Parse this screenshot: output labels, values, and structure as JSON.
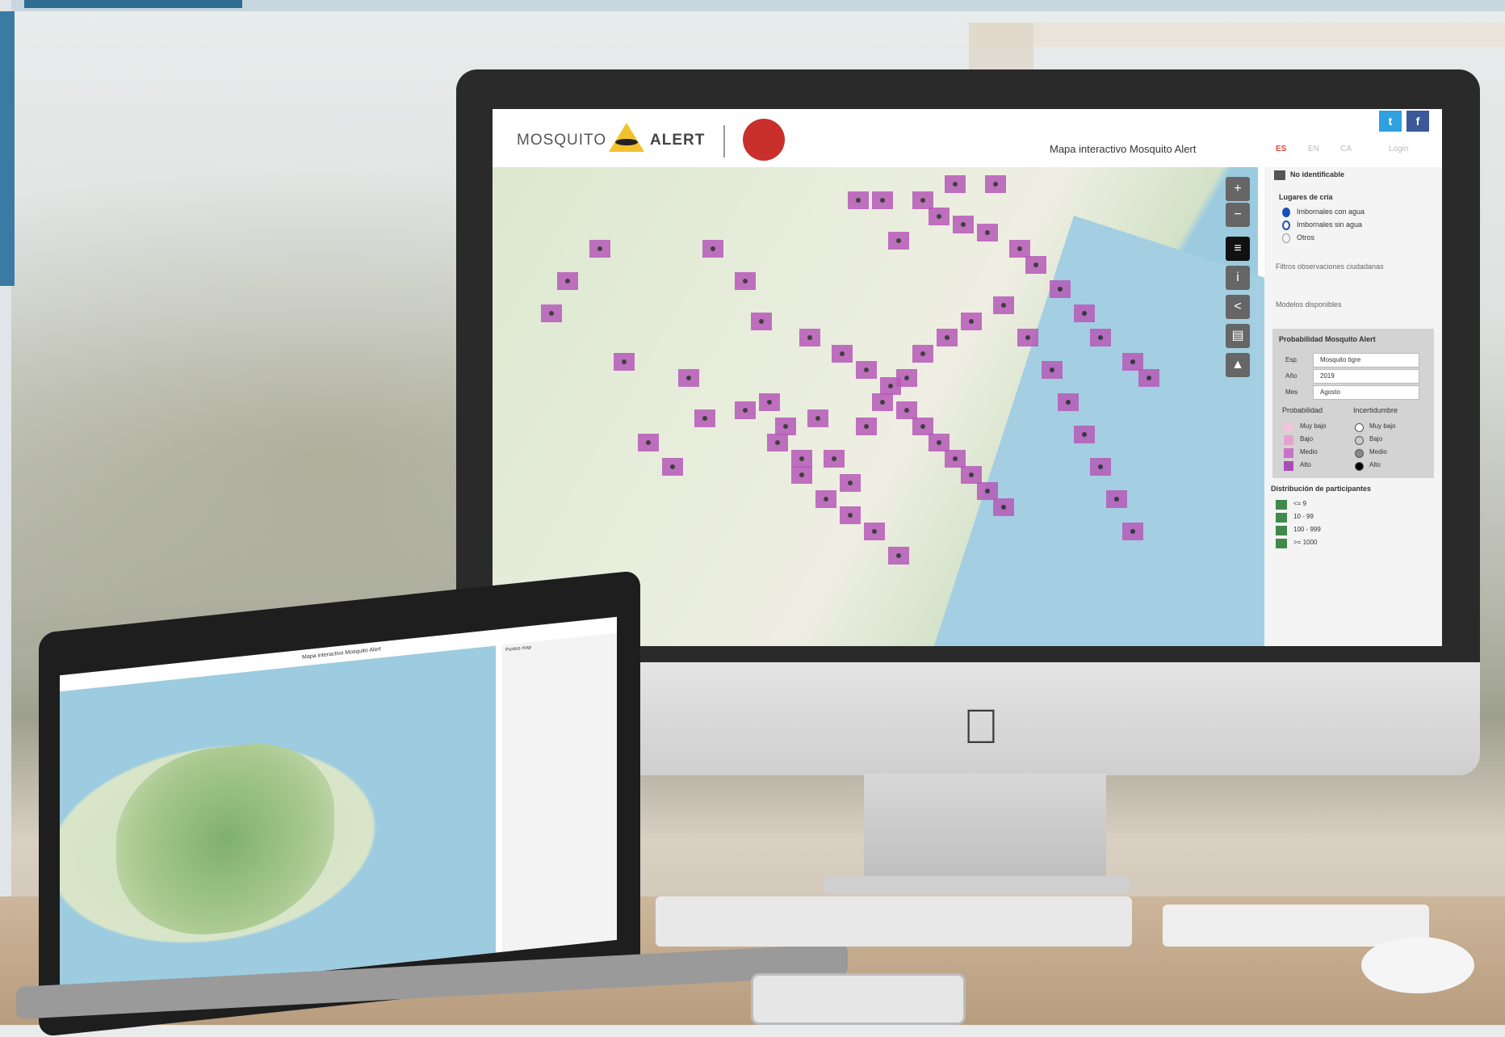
{
  "imac_app": {
    "logo": {
      "word1": "MOSQUITO",
      "word2": "ALERT"
    },
    "title": "Mapa interactivo Mosquito Alert",
    "languages": [
      "ES",
      "EN",
      "CA"
    ],
    "login": "Login",
    "social": [
      "t",
      "f"
    ],
    "map_controls": [
      "+",
      "−",
      "≡",
      "i",
      "<",
      "▤",
      "▲"
    ],
    "sidebar": {
      "top_item": "No identificable",
      "breeding_title": "Lugares de cría",
      "breeding_items": [
        "Imbornales con agua",
        "Imbornales sin agua",
        "Otros"
      ],
      "filter_section": "Filtros observaciones ciudadanas",
      "models_section": "Modelos disponibles",
      "probability_panel": {
        "title": "Probabilidad Mosquito Alert",
        "fields": [
          {
            "label": "Esp.",
            "value": "Mosquito tigre"
          },
          {
            "label": "Año",
            "value": "2019"
          },
          {
            "label": "Mes",
            "value": "Agosto"
          }
        ],
        "prob_header": "Probabilidad",
        "unc_header": "Incertidumbre",
        "prob_levels": [
          "Muy bajo",
          "Bajo",
          "Medio",
          "Alto"
        ],
        "unc_levels": [
          "Muy bajo",
          "Bajo",
          "Medio",
          "Alto"
        ]
      },
      "participants_title": "Distribución de participantes",
      "participants_ranges": [
        "<= 9",
        "10 - 99",
        "100 - 999",
        ">= 1000"
      ]
    }
  },
  "laptop_app": {
    "title": "Mapa interactivo Mosquito Alert",
    "layer_tag": "Puntos map"
  },
  "colors": {
    "probability": [
      "#f0c6dc",
      "#e3a3d0",
      "#c872c6",
      "#a94db4"
    ],
    "participants": "#3f8a4a",
    "accent": "#d44"
  }
}
